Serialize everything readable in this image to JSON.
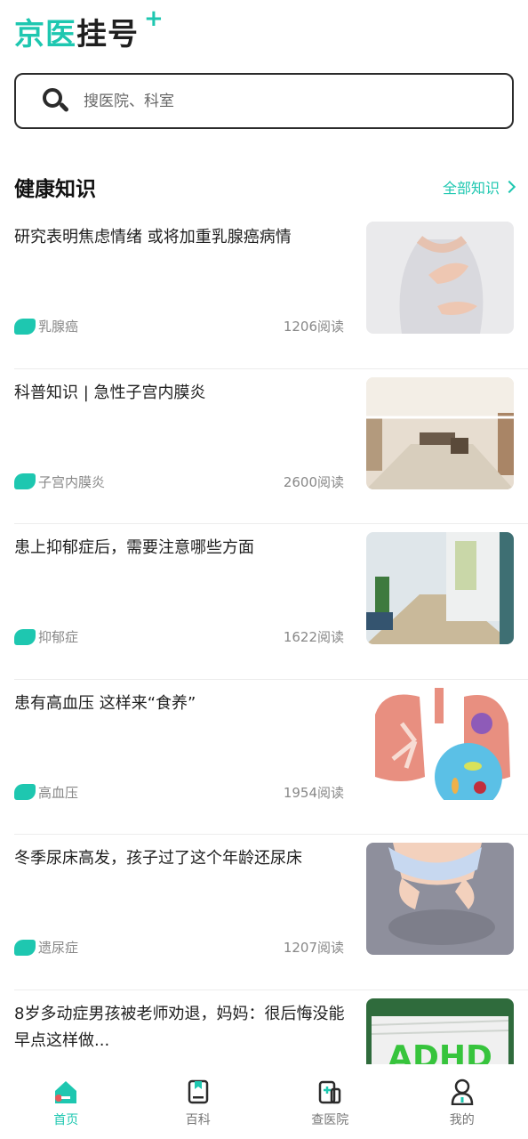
{
  "app": {
    "logo_part1": "京医",
    "logo_part2": "挂号",
    "logo_plus": "+"
  },
  "search": {
    "placeholder": "搜医院、科室"
  },
  "section": {
    "title": "健康知识",
    "all_link": "全部知识"
  },
  "articles": [
    {
      "title": "研究表明焦虑情绪 或将加重乳腺癌病情",
      "tag": "乳腺癌",
      "reads": "1206阅读"
    },
    {
      "title": "科普知识 | 急性子宫内膜炎",
      "tag": "子宫内膜炎",
      "reads": "2600阅读"
    },
    {
      "title": "患上抑郁症后，需要注意哪些方面",
      "tag": "抑郁症",
      "reads": "1622阅读"
    },
    {
      "title": "患有高血压 这样来“食养”",
      "tag": "高血压",
      "reads": "1954阅读"
    },
    {
      "title": "冬季尿床高发，孩子过了这个年龄还尿床",
      "tag": "遗尿症",
      "reads": "1207阅读"
    },
    {
      "title": "8岁多动症男孩被老师劝退，妈妈：很后悔没能早点这样做...",
      "thumb_text": "ADHD"
    }
  ],
  "tabbar": {
    "tabs": [
      {
        "label": "首页",
        "icon": "home-icon",
        "active": true
      },
      {
        "label": "百科",
        "icon": "book-icon",
        "active": false
      },
      {
        "label": "查医院",
        "icon": "hospital-icon",
        "active": false
      },
      {
        "label": "我的",
        "icon": "user-icon",
        "active": false
      }
    ]
  },
  "colors": {
    "accent": "#1ec7b0",
    "text": "#1f1f1f",
    "muted": "#888888"
  }
}
